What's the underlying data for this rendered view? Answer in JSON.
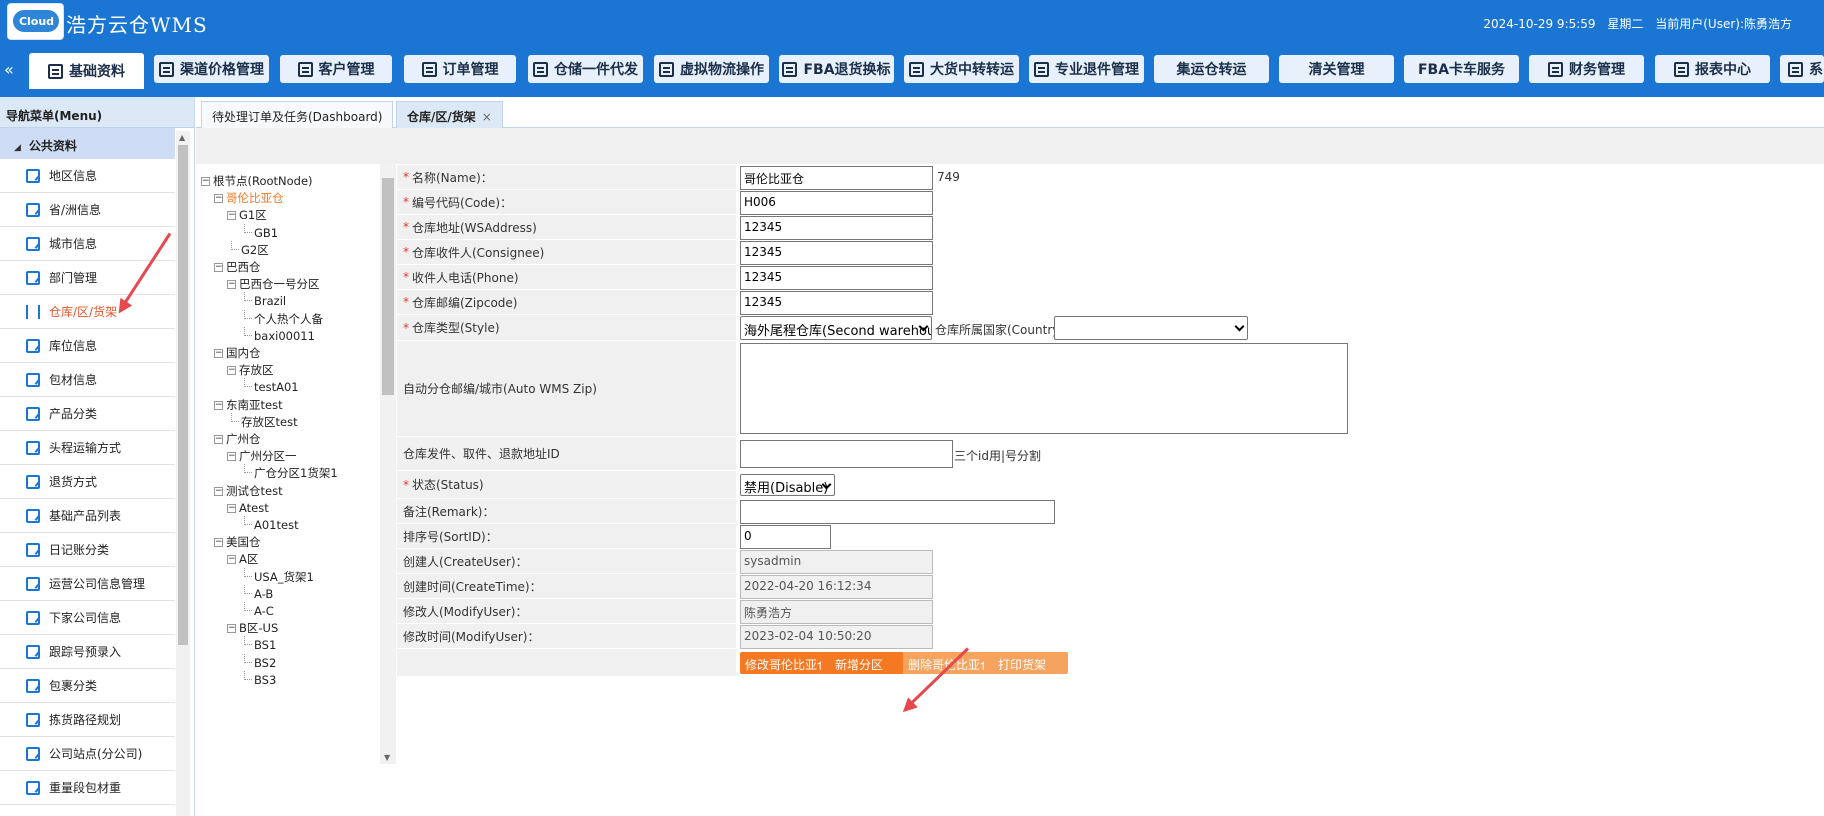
{
  "header": {
    "logo_text": "Cloud",
    "app_title": "浩方云仓WMS",
    "datetime": "2024-10-29 9:5:59",
    "weekday": "星期二",
    "user": "当前用户(User):陈勇浩方"
  },
  "menu": {
    "toggle": "«",
    "items": [
      "基础资料",
      "渠道价格管理",
      "客户管理",
      "订单管理",
      "仓储一件代发",
      "虚拟物流操作",
      "FBA退货换标",
      "大货中转转运",
      "专业退件管理",
      "集运仓转运",
      "清关管理",
      "FBA卡车服务",
      "财务管理",
      "报表中心",
      "系"
    ]
  },
  "sidebar": {
    "header": "导航菜单(Menu)",
    "group": "公共资料",
    "items": [
      "地区信息",
      "省/洲信息",
      "城市信息",
      "部门管理",
      "仓库/区/货架",
      "库位信息",
      "包材信息",
      "产品分类",
      "头程运输方式",
      "退货方式",
      "基础产品列表",
      "日记账分类",
      "运营公司信息管理",
      "下家公司信息",
      "跟踪号预录入",
      "包裹分类",
      "拣货路径规划",
      "公司站点(分公司)",
      "重量段包材重"
    ]
  },
  "tabs": [
    {
      "label": "待处理订单及任务(Dashboard)"
    },
    {
      "label": "仓库/区/货架",
      "close": "×"
    }
  ],
  "tree": {
    "nodes": [
      "根节点(RootNode)",
      "哥伦比亚仓",
      "G1区",
      "GB1",
      "G2区",
      "巴西仓",
      "巴西仓一号分区",
      "Brazil",
      "个人热个人备",
      "baxi00011",
      "国内仓",
      "存放区",
      "testA01",
      "东南亚test",
      "存放区test",
      "广州仓",
      "广州分区一",
      "广仓分区1货架1",
      "测试仓test",
      "Atest",
      "A01test",
      "美国仓",
      "A区",
      "USA_货架1",
      "A-B",
      "A-C",
      "B区-US",
      "BS1",
      "BS2",
      "BS3"
    ]
  },
  "form": {
    "name_label": "名称(Name)：",
    "name_value": "哥伦比亚仓",
    "name_id": "749",
    "code_label": "编号代码(Code)：",
    "code_value": "H006",
    "address_label": "仓库地址(WSAddress)",
    "address_value": "12345",
    "consignee_label": "仓库收件人(Consignee)",
    "consignee_value": "12345",
    "phone_label": "收件人电话(Phone)",
    "phone_value": "12345",
    "zip_label": "仓库邮编(Zipcode)",
    "zip_value": "12345",
    "style_label": "仓库类型(Style)",
    "style_value": "海外尾程仓库(Second warehouse)",
    "country_label": "仓库所属国家(Country)：",
    "country_value": "",
    "autozip_label": "自动分仓邮编/城市(Auto WMS Zip)",
    "autozip_value": "",
    "pickup_label": "仓库发件、取件、退款地址ID",
    "pickup_value": "",
    "pickup_note": "三个id用|号分割",
    "status_label": "状态(Status)",
    "status_value": "禁用(Disable)",
    "remark_label": "备注(Remark)：",
    "remark_value": "",
    "sort_label": "排序号(SortID)：",
    "sort_value": "0",
    "createuser_label": "创建人(CreateUser)：",
    "createuser_value": "sysadmin",
    "createtime_label": "创建时间(CreateTime)：",
    "createtime_value": "2022-04-20 16:12:34",
    "modifyuser_label": "修改人(ModifyUser)：",
    "modifyuser_value": "陈勇浩方",
    "modifytime_label": "修改时间(ModifyUser)：",
    "modifytime_value": "2023-02-04 10:50:20",
    "required_mark": "*",
    "buttons": {
      "modify": "修改哥伦比亚仓",
      "add_zone": "新增分区",
      "delete": "删除哥伦比亚仓",
      "print": "打印货架"
    }
  },
  "colors": {
    "brand": "#1a76d2",
    "action": "#f57822",
    "selected": "#f07a2a",
    "annotation": "#e5484d"
  }
}
